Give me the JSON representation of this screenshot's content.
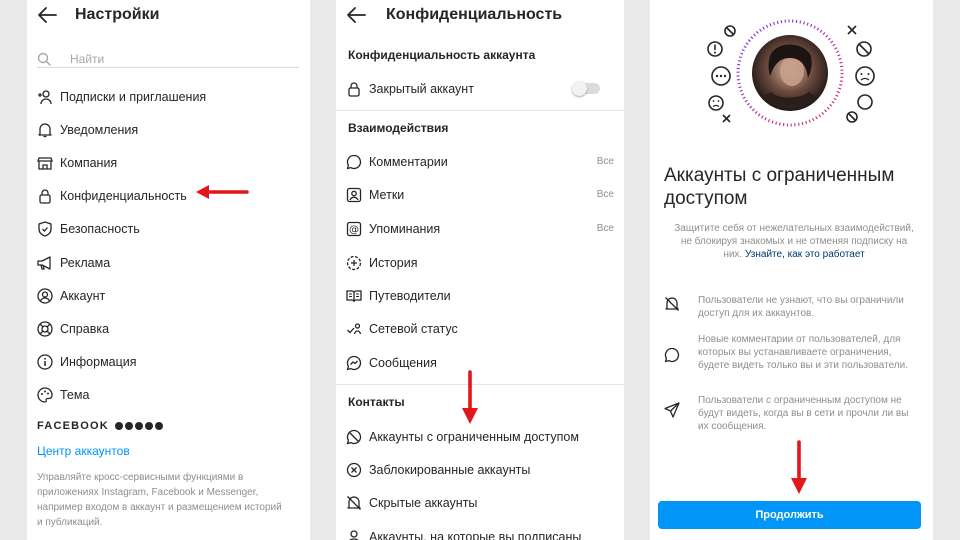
{
  "colors": {
    "accent": "#0095f6",
    "arrow": "#e3161b",
    "text": "#262626",
    "muted": "#8e8e8e"
  },
  "settings": {
    "title": "Настройки",
    "search_placeholder": "Найти",
    "items": [
      {
        "label": "Подписки и приглашения",
        "icon": "add-person-icon"
      },
      {
        "label": "Уведомления",
        "icon": "bell-icon"
      },
      {
        "label": "Компания",
        "icon": "shop-icon"
      },
      {
        "label": "Конфиденциальность",
        "icon": "lock-icon"
      },
      {
        "label": "Безопасность",
        "icon": "shield-icon"
      },
      {
        "label": "Реклама",
        "icon": "megaphone-icon"
      },
      {
        "label": "Аккаунт",
        "icon": "account-icon"
      },
      {
        "label": "Справка",
        "icon": "lifebuoy-icon"
      },
      {
        "label": "Информация",
        "icon": "info-icon"
      },
      {
        "label": "Тема",
        "icon": "palette-icon"
      }
    ],
    "facebook_label": "FACEBOOK",
    "accounts_center": "Центр аккаунтов",
    "accounts_center_desc": "Управляйте кросс-сервисными функциями в приложениях Instagram, Facebook и Messenger, например входом в аккаунт и размещением историй и публикаций."
  },
  "privacy": {
    "title": "Конфиденциальность",
    "account_section": "Конфиденциальность аккаунта",
    "private_account": "Закрытый аккаунт",
    "private_account_on": false,
    "interactions_section": "Взаимодействия",
    "interactions": [
      {
        "label": "Комментарии",
        "value": "Все",
        "icon": "comment-icon"
      },
      {
        "label": "Метки",
        "value": "Все",
        "icon": "tag-person-icon"
      },
      {
        "label": "Упоминания",
        "value": "Все",
        "icon": "at-icon"
      },
      {
        "label": "История",
        "value": "",
        "icon": "story-plus-icon"
      },
      {
        "label": "Путеводители",
        "value": "",
        "icon": "guide-book-icon"
      },
      {
        "label": "Сетевой статус",
        "value": "",
        "icon": "activity-status-icon"
      },
      {
        "label": "Сообщения",
        "value": "",
        "icon": "messenger-icon"
      }
    ],
    "contacts_section": "Контакты",
    "contacts": [
      {
        "label": "Аккаунты с ограниченным доступом",
        "icon": "restricted-icon"
      },
      {
        "label": "Заблокированные аккаунты",
        "icon": "blocked-icon"
      },
      {
        "label": "Скрытые аккаунты",
        "icon": "muted-bell-icon"
      },
      {
        "label": "Аккаунты, на которые вы подписаны",
        "icon": "following-icon"
      }
    ]
  },
  "restricted": {
    "title": "Аккаунты с ограниченным доступом",
    "lead": "Защитите себя от нежелательных взаимодействий, не блокируя знакомых и не отменяя подписку на них.",
    "lead_link": "Узнайте, как это работает",
    "features": [
      {
        "text": "Пользователи не узнают, что вы ограничили доступ для их аккаунтов.",
        "icon": "bell-off-icon"
      },
      {
        "text": "Новые комментарии от пользователей, для которых вы устанавливаете ограничения, будете видеть только вы и эти пользователи.",
        "icon": "comment-icon"
      },
      {
        "text": "Пользователи с ограниченным доступом не будут видеть, когда вы в сети и прочли ли вы их сообщения.",
        "icon": "send-icon"
      }
    ],
    "continue": "Продолжить"
  }
}
